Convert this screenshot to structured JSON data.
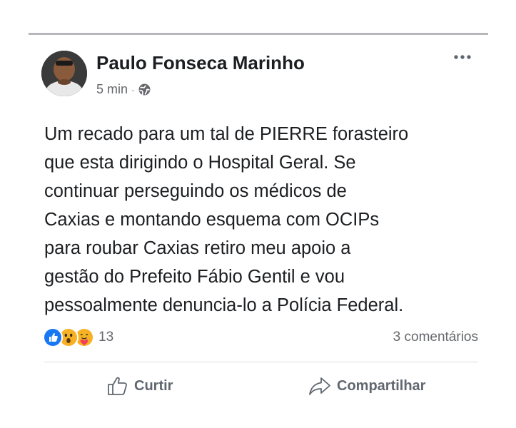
{
  "post": {
    "author": "Paulo Fonseca Marinho",
    "time": "5 min",
    "separator": "·",
    "privacy_icon": "globe-icon",
    "more_icon": "more-options-icon",
    "text_lines": [
      "Um recado para um tal de PIERRE forasteiro",
      "que esta dirigindo o Hospital Geral. Se",
      "continuar perseguindo os médicos de",
      "Caxias e montando esquema com OCIPs",
      "para roubar Caxias retiro meu apoio a",
      "gestão do Prefeito Fábio Gentil e vou",
      "pessoalmente denuncia-lo a Polícia Federal."
    ]
  },
  "engagement": {
    "reactions": [
      "like",
      "wow",
      "care"
    ],
    "reaction_count": "13",
    "comments_label": "3 comentários"
  },
  "actions": {
    "like_label": "Curtir",
    "like_icon": "thumbs-up-icon",
    "share_label": "Compartilhar",
    "share_icon": "share-arrow-icon"
  },
  "colors": {
    "text_primary": "#1c1e21",
    "text_secondary": "#65676b",
    "like_blue": "#1877f2",
    "wow_yellow": "#f7b125",
    "divider": "#dadde1"
  }
}
